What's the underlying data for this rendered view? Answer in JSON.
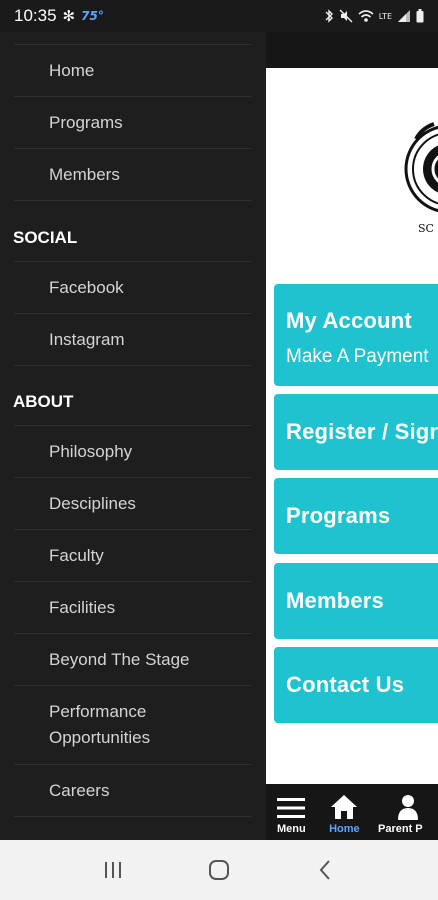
{
  "status_bar": {
    "time": "10:35",
    "fan_glyph": "✻",
    "temperature": "75°",
    "lte_label": "LTE"
  },
  "drawer": {
    "top_items": [
      {
        "label": "Home"
      },
      {
        "label": "Programs"
      },
      {
        "label": "Members"
      }
    ],
    "sections": [
      {
        "title": "SOCIAL",
        "items": [
          {
            "label": "Facebook"
          },
          {
            "label": "Instagram"
          }
        ]
      },
      {
        "title": "ABOUT",
        "items": [
          {
            "label": "Philosophy"
          },
          {
            "label": "Desciplines"
          },
          {
            "label": "Faculty"
          },
          {
            "label": "Facilities"
          },
          {
            "label": "Beyond The Stage"
          },
          {
            "label": "Performance Opportunities"
          },
          {
            "label": "Careers"
          }
        ]
      }
    ]
  },
  "main": {
    "logo_text": "SC",
    "cards": [
      {
        "title": "My Account",
        "subtitle": "Make A Payment"
      },
      {
        "title": "Register / Sign"
      },
      {
        "title": "Programs"
      },
      {
        "title": "Members"
      },
      {
        "title": "Contact Us"
      }
    ],
    "bottom_nav": [
      {
        "label": "Menu",
        "icon": "hamburger-icon"
      },
      {
        "label": "Home",
        "icon": "home-icon",
        "active": true
      },
      {
        "label": "Parent P",
        "icon": "person-icon"
      }
    ]
  },
  "colors": {
    "accent": "#1ec3cf",
    "drawer_bg": "#1e1e1e",
    "active_nav": "#5aa6ff"
  }
}
